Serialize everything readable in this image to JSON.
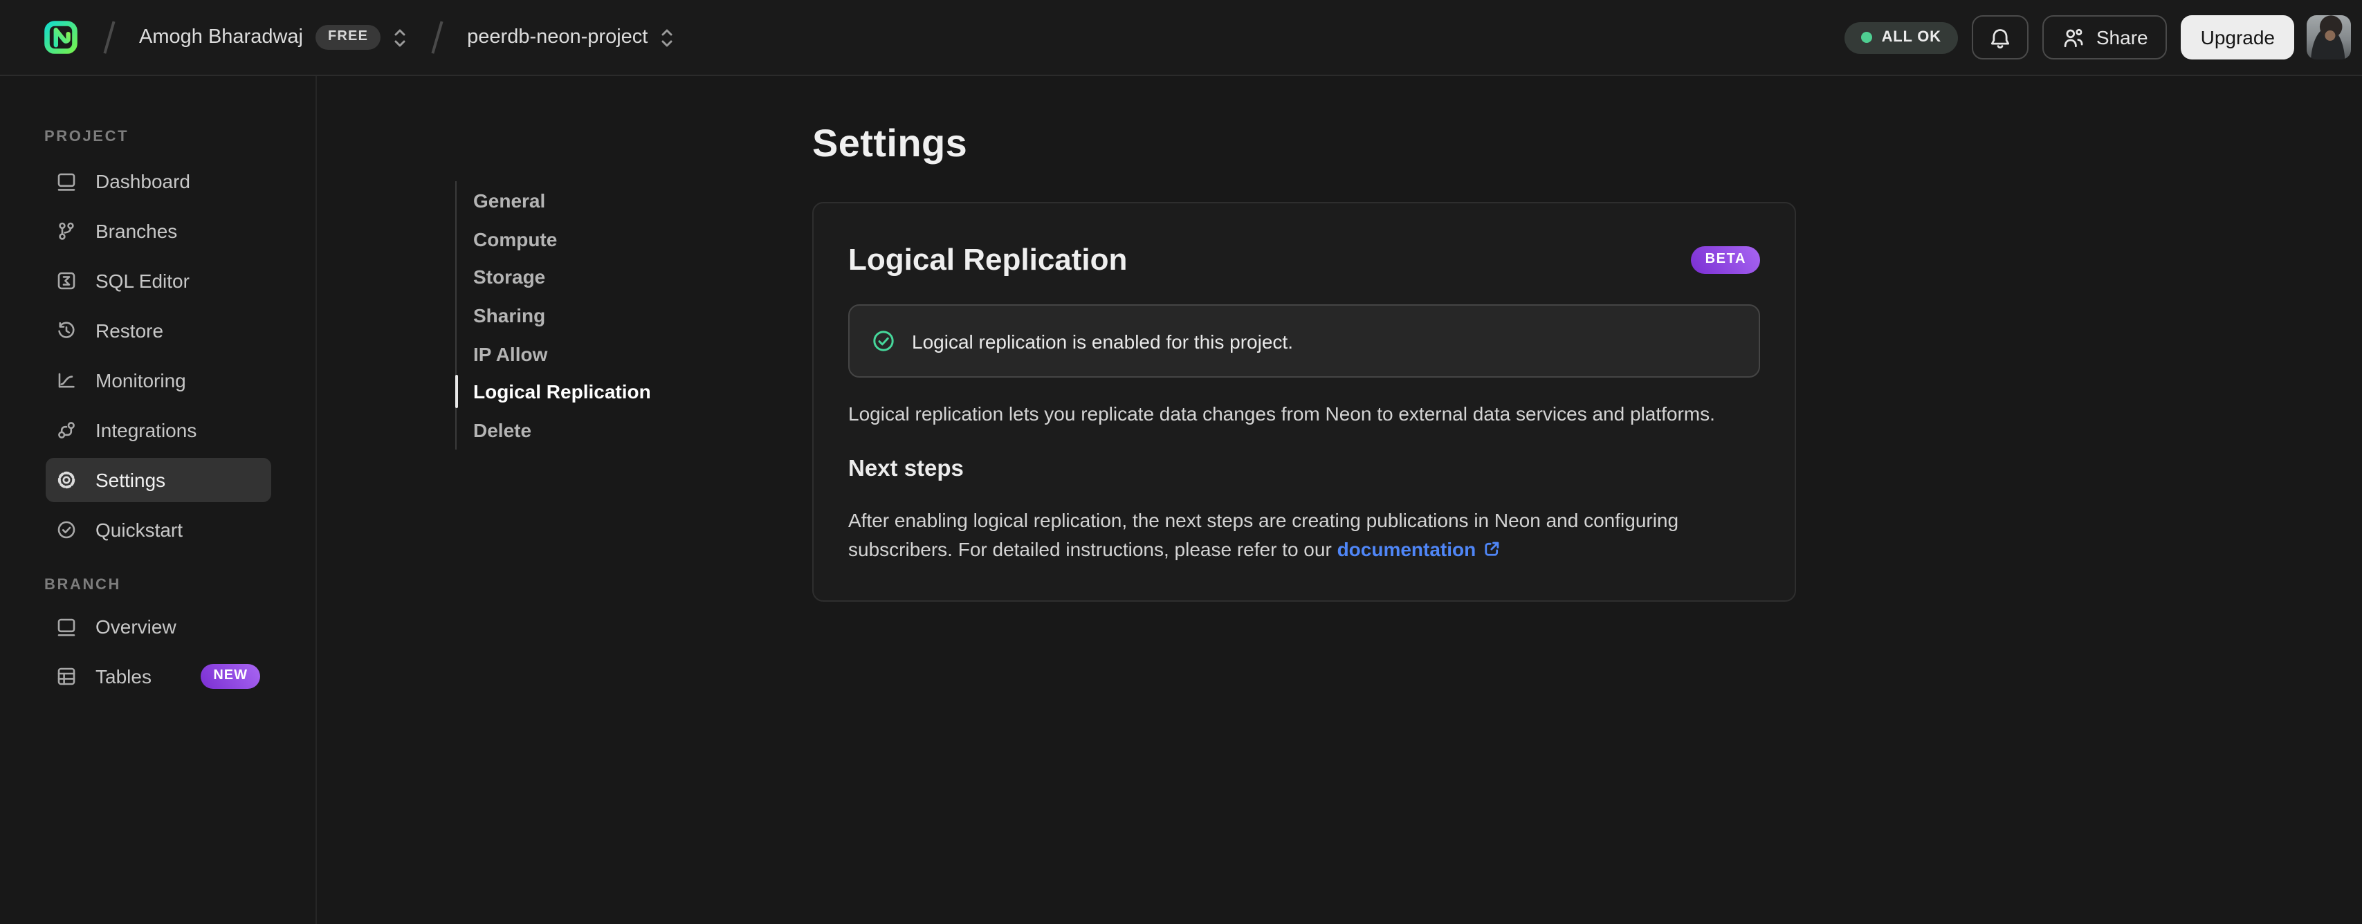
{
  "header": {
    "logo": "neon-logo",
    "org": {
      "name": "Amogh Bharadwaj",
      "plan_badge": "FREE"
    },
    "project": {
      "name": "peerdb-neon-project"
    },
    "status": {
      "label": "ALL OK",
      "color": "#4fcf92"
    },
    "share_label": "Share",
    "upgrade_label": "Upgrade"
  },
  "sidebar": {
    "sections": [
      {
        "label": "PROJECT",
        "items": [
          {
            "label": "Dashboard",
            "icon": "dashboard-icon",
            "active": false
          },
          {
            "label": "Branches",
            "icon": "git-branch-icon",
            "active": false
          },
          {
            "label": "SQL Editor",
            "icon": "sql-editor-icon",
            "active": false
          },
          {
            "label": "Restore",
            "icon": "restore-clock-icon",
            "active": false
          },
          {
            "label": "Monitoring",
            "icon": "monitoring-chart-icon",
            "active": false
          },
          {
            "label": "Integrations",
            "icon": "integrations-icon",
            "active": false
          },
          {
            "label": "Settings",
            "icon": "gear-icon",
            "active": true
          },
          {
            "label": "Quickstart",
            "icon": "check-circle-icon",
            "active": false
          }
        ]
      },
      {
        "label": "BRANCH",
        "items": [
          {
            "label": "Overview",
            "icon": "window-icon",
            "active": false
          },
          {
            "label": "Tables",
            "icon": "table-icon",
            "badge": "NEW",
            "active": false
          }
        ]
      }
    ]
  },
  "settings_nav": {
    "items": [
      {
        "label": "General",
        "active": false
      },
      {
        "label": "Compute",
        "active": false
      },
      {
        "label": "Storage",
        "active": false
      },
      {
        "label": "Sharing",
        "active": false
      },
      {
        "label": "IP Allow",
        "active": false
      },
      {
        "label": "Logical Replication",
        "active": true
      },
      {
        "label": "Delete",
        "active": false
      }
    ]
  },
  "main": {
    "page_title": "Settings",
    "card": {
      "title": "Logical Replication",
      "beta_badge": "BETA",
      "alert_text": "Logical replication is enabled for this project.",
      "description": "Logical replication lets you replicate data changes from Neon to external data services and platforms.",
      "next_steps_title": "Next steps",
      "next_steps_text": "After enabling logical replication, the next steps are creating publications in Neon and configuring subscribers. For detailed instructions, please refer to our ",
      "doc_link_label": "documentation"
    }
  },
  "colors": {
    "background": "#181818",
    "card_background": "#1c1c1c",
    "accent_green": "#46d79b",
    "badge_purple_start": "#7b2fd3",
    "badge_purple_end": "#a866f2",
    "link_blue": "#4f86f7"
  }
}
